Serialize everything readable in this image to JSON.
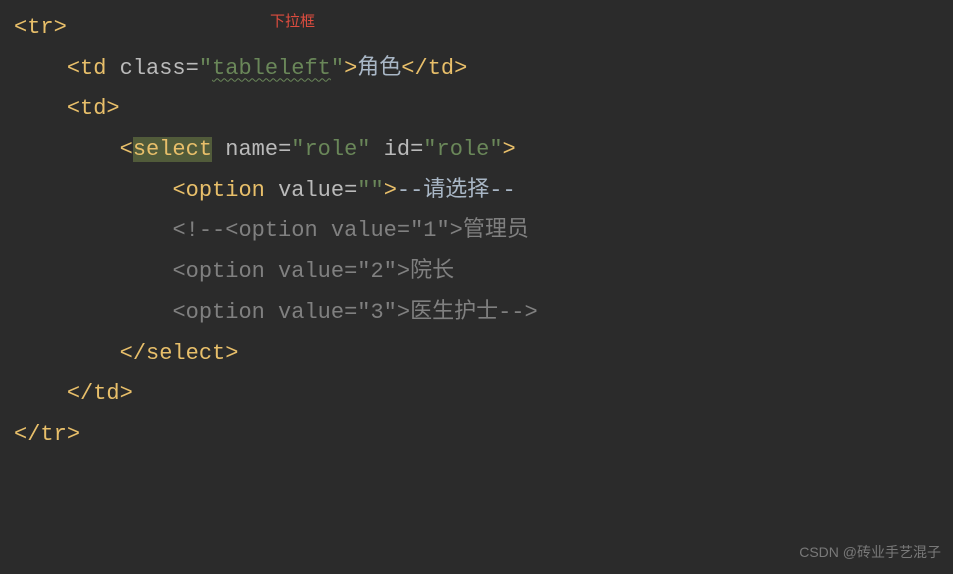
{
  "annotation": "下拉框",
  "lines": {
    "l1": {
      "tag_open": "<",
      "tag_name": "tr",
      "tag_close": ">"
    },
    "l2": {
      "indent": "    ",
      "open": "<",
      "tag": "td",
      "sp": " ",
      "attr": "class",
      "eq": "=",
      "q1": "\"",
      "val": "tableleft",
      "q2": "\"",
      "close": ">",
      "text": "角色",
      "end_open": "</",
      "end_tag": "td",
      "end_close": ">"
    },
    "l3": {
      "indent": "    ",
      "open": "<",
      "tag": "td",
      "close": ">"
    },
    "l4": {
      "indent": "        ",
      "open": "<",
      "tag": "select",
      "sp1": " ",
      "attr1": "name",
      "eq1": "=",
      "q1a": "\"",
      "val1": "role",
      "q1b": "\"",
      "sp2": " ",
      "attr2": "id",
      "eq2": "=",
      "q2a": "\"",
      "val2": "role",
      "q2b": "\"",
      "close": ">"
    },
    "l5": {
      "indent": "            ",
      "open": "<",
      "tag": "option",
      "sp": " ",
      "attr": "value",
      "eq": "=",
      "q1": "\"",
      "val": "",
      "q2": "\"",
      "close": ">",
      "text": "--请选择--"
    },
    "l6": {
      "indent": "            ",
      "comment": "<!--<option value=\"1\">",
      "text": "管理员"
    },
    "l7": {
      "indent": "            ",
      "comment": "<option value=\"2\">",
      "text": "院长"
    },
    "l8": {
      "indent": "            ",
      "comment": "<option value=\"3\">",
      "text": "医生护士",
      "cend": "-->"
    },
    "l9": {
      "indent": "        ",
      "open": "</",
      "tag": "select",
      "close": ">"
    },
    "l10": {
      "indent": "    ",
      "open": "</",
      "tag": "td",
      "close": ">"
    },
    "l11": {
      "open": "</",
      "tag": "tr",
      "close": ">"
    }
  },
  "watermark": "CSDN @砖业手艺混子"
}
